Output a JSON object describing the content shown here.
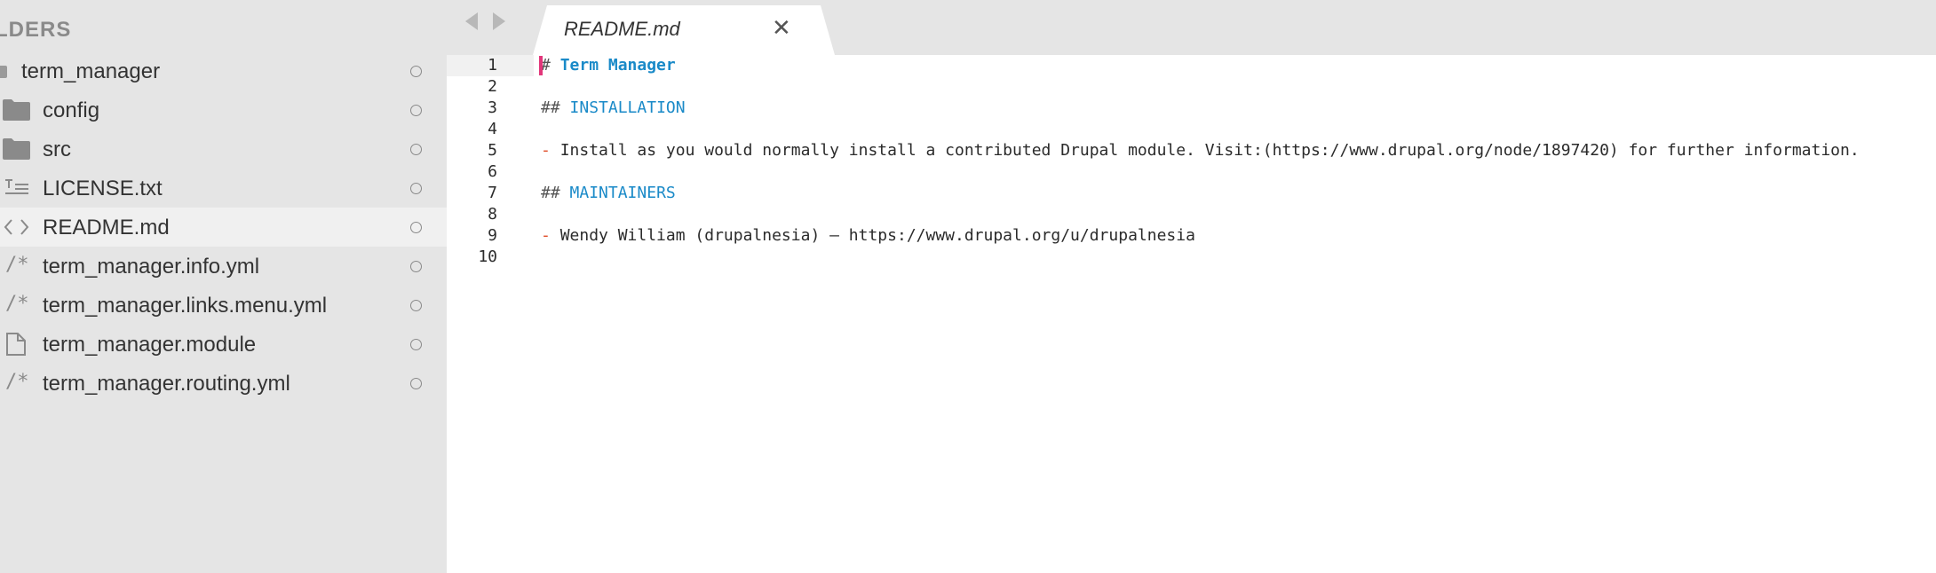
{
  "sidebar": {
    "header": "LDERS",
    "root": "term_manager",
    "items": [
      {
        "label": "config",
        "icon": "folder-icon",
        "kind": "folder"
      },
      {
        "label": "src",
        "icon": "folder-icon",
        "kind": "folder"
      },
      {
        "label": "LICENSE.txt",
        "icon": "text-file-icon",
        "kind": "text"
      },
      {
        "label": "README.md",
        "icon": "code-brackets-icon",
        "kind": "code",
        "selected": true
      },
      {
        "label": "term_manager.info.yml",
        "icon": "comment-slash-icon",
        "kind": "yml"
      },
      {
        "label": "term_manager.links.menu.yml",
        "icon": "comment-slash-icon",
        "kind": "yml"
      },
      {
        "label": "term_manager.module",
        "icon": "file-icon",
        "kind": "file"
      },
      {
        "label": "term_manager.routing.yml",
        "icon": "comment-slash-icon",
        "kind": "yml"
      }
    ]
  },
  "tab": {
    "title": "README.md",
    "close_glyph": "✕"
  },
  "editor": {
    "line_numbers": [
      "1",
      "2",
      "3",
      "4",
      "5",
      "6",
      "7",
      "8",
      "9",
      "10"
    ],
    "lines": {
      "l1_punct": "#",
      "l1_text": "Term Manager",
      "l3_punct": "##",
      "l3_text": "INSTALLATION",
      "l5_bullet": "-",
      "l5_text": "Install as you would normally install a contributed Drupal module. Visit:(https://www.drupal.org/node/1897420) for further information.",
      "l7_punct": "##",
      "l7_text": "MAINTAINERS",
      "l9_bullet": "-",
      "l9_text": "Wendy William (drupalnesia) — https://www.drupal.org/u/drupalnesia"
    }
  },
  "colors": {
    "sidebar_bg": "#e5e5e5",
    "heading": "#1a8ac8",
    "bullet": "#e0502c",
    "cursor": "#e2367a"
  }
}
